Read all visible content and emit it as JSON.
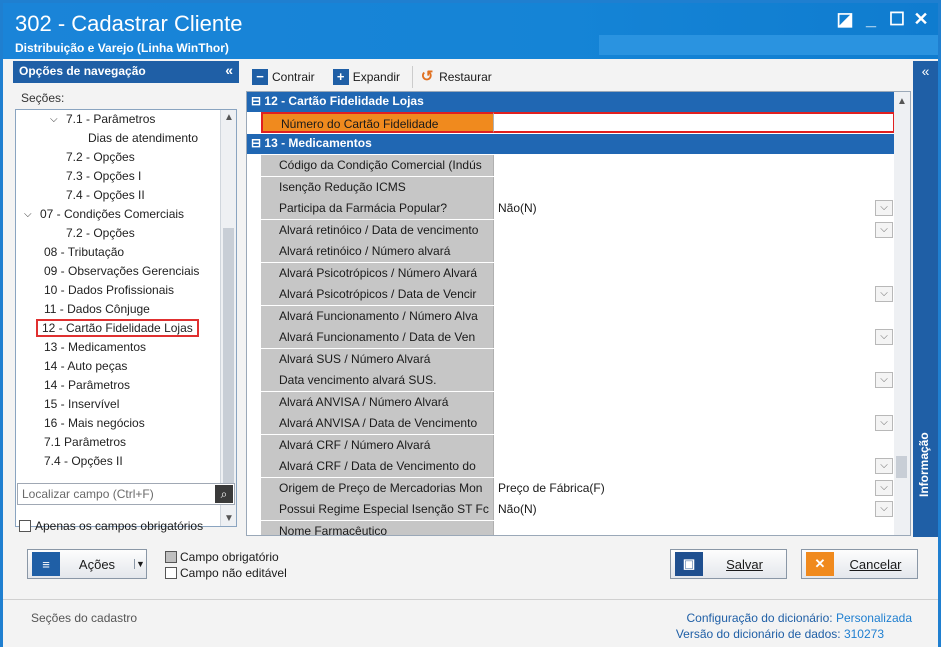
{
  "window": {
    "title": "302 - Cadastrar Cliente",
    "subtitle": "Distribuição e Varejo (Linha WinThor)"
  },
  "nav": {
    "header": "Opções de navegação",
    "sections_label": "Seções:",
    "items": [
      "7.1 - Parâmetros",
      "Dias de atendimento",
      "7.2 - Opções",
      "7.3 - Opções I",
      "7.4 - Opções II",
      "07 - Condições Comerciais",
      "7.2 - Opções",
      "08 - Tributação",
      "09 - Observações Gerenciais",
      "10 - Dados Profissionais",
      "11 - Dados Cônjuge",
      "12 - Cartão Fidelidade Lojas",
      "13 - Medicamentos",
      "14 - Auto peças",
      "14 - Parâmetros",
      "15 - Inservível",
      "16 - Mais negócios",
      "7.1 Parâmetros",
      "7.4 - Opções II"
    ],
    "search_placeholder": "Localizar campo (Ctrl+F)",
    "only_required": "Apenas os campos obrigatórios"
  },
  "toolbar": {
    "collapse": "Contrair",
    "expand": "Expandir",
    "restore": "Restaurar"
  },
  "grid": {
    "group12": "12 - Cartão Fidelidade Lojas",
    "group13": "13 - Medicamentos",
    "rows": [
      {
        "label": "Número do Cartão Fidelidade",
        "value": ""
      },
      {
        "label": "Código da Condição Comercial (Indús",
        "value": ""
      },
      {
        "label": "Isenção Redução ICMS",
        "value": ""
      },
      {
        "label": "Participa da Farmácia Popular?",
        "value": "Não(N)"
      },
      {
        "label": "Alvará retinóico / Data de vencimento",
        "value": ""
      },
      {
        "label": "Alvará retinóico / Número alvará",
        "value": ""
      },
      {
        "label": "Alvará Psicotrópicos / Número Alvará",
        "value": ""
      },
      {
        "label": "Alvará Psicotrópicos / Data  de Vencir",
        "value": ""
      },
      {
        "label": "Alvará Funcionamento / Número Alva",
        "value": ""
      },
      {
        "label": "Alvará Funcionamento / Data  de Ven",
        "value": ""
      },
      {
        "label": "Alvará SUS / Número Alvará",
        "value": ""
      },
      {
        "label": "Data vencimento alvará SUS.",
        "value": ""
      },
      {
        "label": "Alvará ANVISA / Número Alvará",
        "value": ""
      },
      {
        "label": "Alvará ANVISA / Data  de Vencimento",
        "value": ""
      },
      {
        "label": "Alvará CRF / Número Alvará",
        "value": ""
      },
      {
        "label": "Alvará CRF / Data  de Vencimento do",
        "value": ""
      },
      {
        "label": "Origem de Preço de Mercadorias Mon",
        "value": "Preço de Fábrica(F)"
      },
      {
        "label": "Possui Regime Especial Isenção ST Fc",
        "value": "Não(N)"
      },
      {
        "label": "Nome Farmacêutico",
        "value": ""
      }
    ]
  },
  "side_panel": "Informação",
  "buttons": {
    "actions": "Ações",
    "save": "Salvar",
    "cancel": "Cancelar"
  },
  "legend": {
    "required": "Campo obrigatório",
    "not_editable": "Campo não editável"
  },
  "status": {
    "left": "Seções do cadastro",
    "dict_config_label": "Configuração do dicionário:",
    "dict_config_value": "Personalizada",
    "dict_version_label": "Versão do dicionário de dados:",
    "dict_version_value": "310273"
  }
}
